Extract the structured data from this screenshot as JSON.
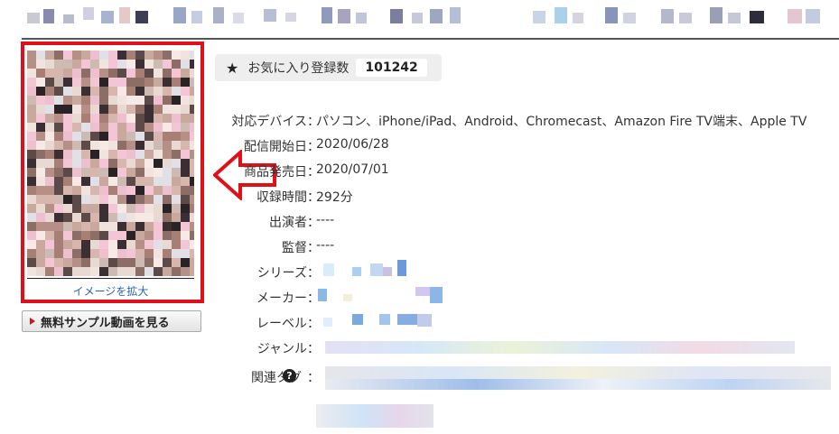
{
  "favorites": {
    "label": "お気に入り登録数",
    "count": "101242",
    "icon": "star-icon"
  },
  "image": {
    "zoom_label": "イメージを拡大"
  },
  "sample_button": {
    "label": "無料サンプル動画を見る"
  },
  "specs": [
    {
      "label": "対応デバイス",
      "value": "パソコン、iPhone/iPad、Android、Chromecast、Amazon Fire TV端末、Apple TV"
    },
    {
      "label": "配信開始日",
      "value": "2020/06/28"
    },
    {
      "label": "商品発売日",
      "value": "2020/07/01"
    },
    {
      "label": "収録時間",
      "value": "292分"
    },
    {
      "label": "出演者",
      "value": "----"
    },
    {
      "label": "監督",
      "value": "----"
    },
    {
      "label": "シリーズ",
      "value": ""
    },
    {
      "label": "メーカー",
      "value": ""
    },
    {
      "label": "レーベル",
      "value": ""
    },
    {
      "label": "ジャンル",
      "value": ""
    },
    {
      "label": "関連タグ",
      "value": ""
    }
  ],
  "colon": "：",
  "help_icon": "?",
  "colors": {
    "highlight_red": "#e0101a",
    "link_blue": "#2a63b5"
  }
}
